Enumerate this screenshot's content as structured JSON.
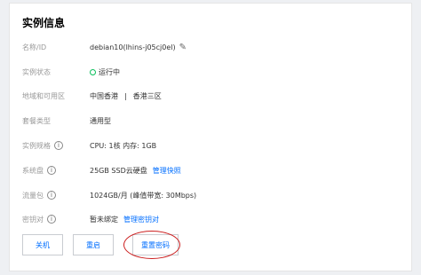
{
  "title": "实例信息",
  "rows": [
    {
      "label": "名称/ID",
      "value": "debian10(lhins-j05cj0el)"
    },
    {
      "label": "实例状态",
      "value": "运行中"
    },
    {
      "label": "地域和可用区",
      "region": "中国香港",
      "separator": "|",
      "zone": "香港三区"
    },
    {
      "label": "套餐类型",
      "value": "通用型"
    },
    {
      "label": "实例规格",
      "value": "CPU: 1核 内存: 1GB"
    },
    {
      "label": "系统盘",
      "value": "25GB SSD云硬盘",
      "link": "管理快照"
    },
    {
      "label": "流量包",
      "value": "1024GB/月 (峰值带宽: 30Mbps)"
    },
    {
      "label": "密钥对",
      "value": "暂未绑定",
      "link": "管理密钥对"
    }
  ],
  "buttons": {
    "shutdown": "关机",
    "restart": "重启",
    "reset_password": "重置密码"
  },
  "colors": {
    "accent": "#006eff",
    "status_green": "#0abf5b",
    "annotation_red": "#cc1f1f"
  }
}
